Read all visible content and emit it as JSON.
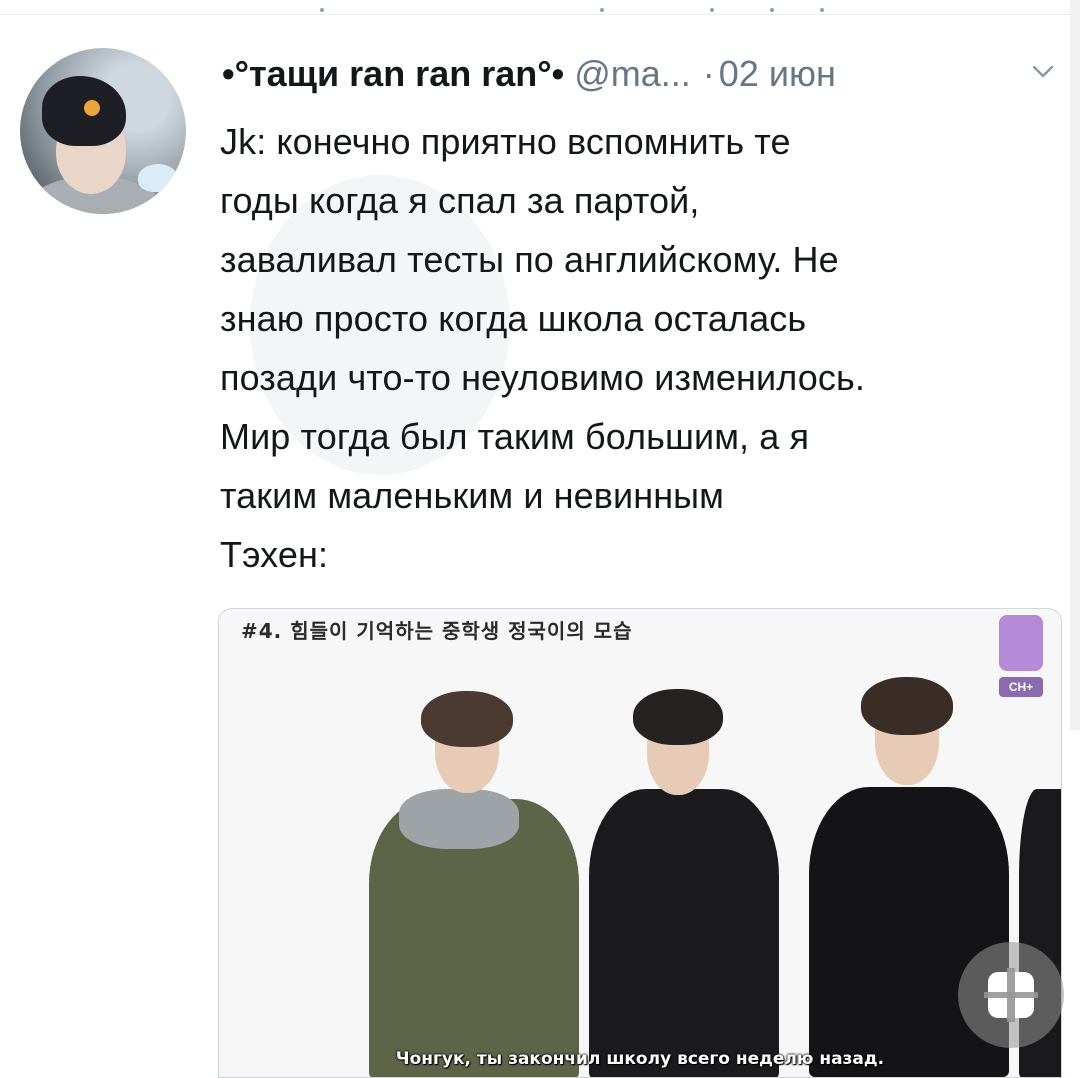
{
  "tweet": {
    "display_name": "•°тащи ran ran ran°•",
    "handle": "@ma...",
    "separator": "·",
    "date": "02 июн",
    "body_lines": [
      "Jk: конечно приятно вспомнить те",
      "годы когда я спал за партой,",
      "заваливал тесты по английскому.  Не",
      "знаю просто когда школа осталась",
      "позади что-то неуловимо изменилось.",
      "Мир тогда был таким большим, а я",
      "таким маленьким и невинным",
      "Тэхен:"
    ]
  },
  "media": {
    "caption": "#4. 힘들이 기억하는 중학생 정국이의 모습",
    "subtitle": "Чонгук, ты закончил школу всего неделю назад.",
    "badge_text": "CH+",
    "colors": {
      "jacket_left": "#5e6447",
      "hoodie_mid": "#1b1b1e",
      "hoodie_right": "#141416"
    }
  },
  "icons": {
    "avatar": "profile-avatar",
    "menu": "chevron-down-icon",
    "lens": "google-lens-icon"
  }
}
